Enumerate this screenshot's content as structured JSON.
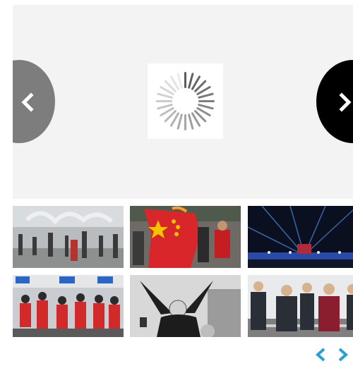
{
  "slider": {
    "loading_icon": "spinner-icon",
    "prev_icon": "chevron-left-icon",
    "next_icon": "chevron-right-icon"
  },
  "thumbnails": [
    {
      "subject": "fountain-crowd-photo"
    },
    {
      "subject": "flag-protest-photo"
    },
    {
      "subject": "stage-lights-photo"
    },
    {
      "subject": "red-shirts-crowd-photo"
    },
    {
      "subject": "speaker-arms-raised-photo"
    },
    {
      "subject": "officials-group-photo"
    }
  ],
  "pager": {
    "prev_icon": "chevron-left-icon",
    "next_icon": "chevron-right-icon",
    "accent_color": "#2a9fd8"
  },
  "colors": {
    "stage_bg": "#f3f3f3",
    "prev_button": "#7d7d7d",
    "next_button": "#000000"
  }
}
